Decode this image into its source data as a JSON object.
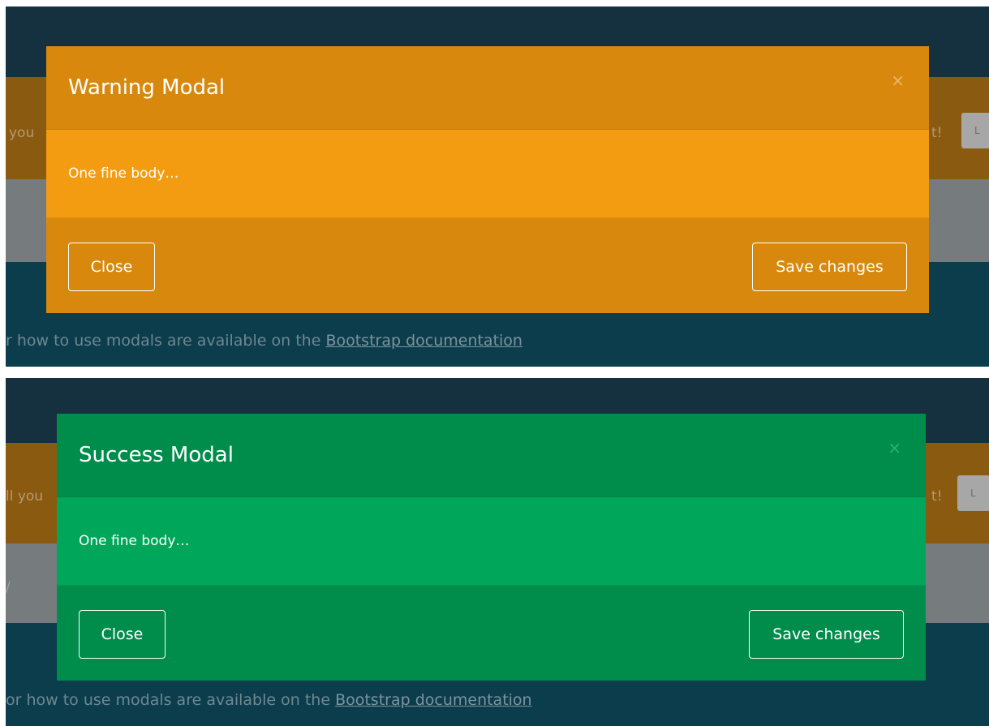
{
  "colors": {
    "warning_header": "#d8890d",
    "warning_body": "#f39c12",
    "success_header": "#008d4c",
    "success_body": "#00a65a",
    "backdrop": "#15303f"
  },
  "icons": {
    "close": "close-icon"
  },
  "warning_modal": {
    "title": "Warning Modal",
    "close_symbol": "×",
    "body": "One fine body…",
    "close_button": "Close",
    "save_button": "Save changes"
  },
  "success_modal": {
    "title": "Success Modal",
    "close_symbol": "×",
    "body": "One fine body…",
    "close_button": "Close",
    "save_button": "Save changes"
  },
  "background": {
    "top": {
      "left_fragment": "you",
      "right_fragment": "t!",
      "button_fragment": "L",
      "footer_text": "r how to use modals are available on the ",
      "footer_link": "Bootstrap documentation"
    },
    "bottom": {
      "left_fragment": "ll you",
      "right_fragment": "t!",
      "button_fragment": "L",
      "gray_fragment": "/",
      "footer_text": "or how to use modals are available on the ",
      "footer_link": "Bootstrap documentation"
    }
  }
}
